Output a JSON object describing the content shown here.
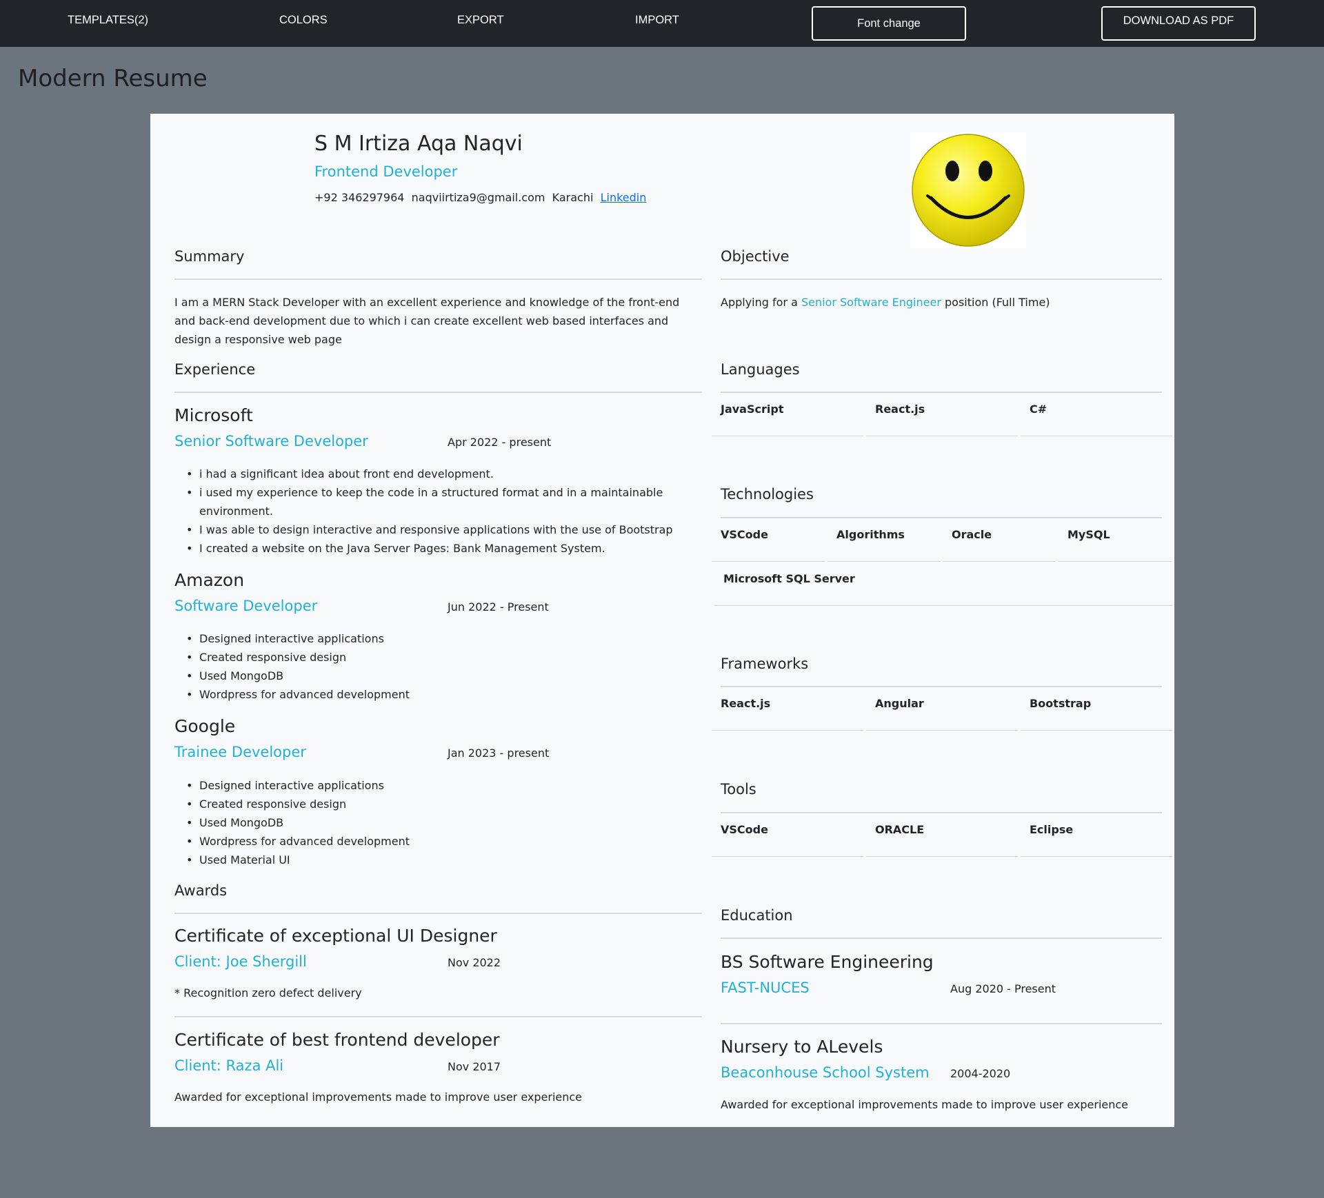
{
  "navbar": {
    "templates": "TEMPLATES(2)",
    "colors": "COLORS",
    "export": "EXPORT",
    "import": "IMPORT",
    "font_change": "Font change",
    "download": "DOWNLOAD AS PDF"
  },
  "page_title": "Modern Resume",
  "header": {
    "name": "S M Irtiza Aqa Naqvi",
    "role": "Frontend Developer",
    "phone": "+92 346297964",
    "email": "naqviirtiza9@gmail.com",
    "city": "Karachi",
    "linkedin": "Linkedin"
  },
  "summary": {
    "title": "Summary",
    "text": "I am a MERN Stack Developer with an excellent experience and knowledge of the front-end and back-end development due to which i can create excellent web based interfaces and design a responsive web page"
  },
  "objective": {
    "title": "Objective",
    "prefix": "Applying for a",
    "position": "Senior Software Engineer",
    "suffix": "position (Full Time)"
  },
  "experience": {
    "title": "Experience",
    "items": [
      {
        "company": "Microsoft",
        "role": "Senior Software Developer",
        "date": "Apr 2022 - present",
        "bullets": [
          "i had a significant idea about front end development.",
          "i used my experience to keep the code in a structured format and in a maintainable environment.",
          "I was able to design interactive and responsive applications with the use of Bootstrap",
          "I created a website on the Java Server Pages: Bank Management System."
        ]
      },
      {
        "company": "Amazon",
        "role": "Software Developer",
        "date": "Jun 2022 - Present",
        "bullets": [
          "Designed interactive applications",
          "Created responsive design",
          "Used MongoDB",
          "Wordpress for advanced development"
        ]
      },
      {
        "company": "Google",
        "role": "Trainee Developer",
        "date": "Jan 2023 - present",
        "bullets": [
          "Designed interactive applications",
          "Created responsive design",
          "Used MongoDB",
          "Wordpress for advanced development",
          "Used Material UI"
        ]
      }
    ]
  },
  "awards": {
    "title": "Awards",
    "items": [
      {
        "title": "Certificate of exceptional UI Designer",
        "client": "Client: Joe Shergill",
        "date": "Nov 2022",
        "desc": "* Recognition zero defect delivery"
      },
      {
        "title": "Certificate of best frontend developer",
        "client": "Client: Raza Ali",
        "date": "Nov 2017",
        "desc": "Awarded for exceptional improvements made to improve user experience"
      }
    ]
  },
  "languages": {
    "title": "Languages",
    "items": [
      "JavaScript",
      "React.js",
      "C#"
    ]
  },
  "technologies": {
    "title": "Technologies",
    "items": [
      "VSCode",
      "Algorithms",
      "Oracle",
      "MySQL",
      "Microsoft SQL Server"
    ]
  },
  "frameworks": {
    "title": "Frameworks",
    "items": [
      "React.js",
      "Angular",
      "Bootstrap"
    ]
  },
  "tools": {
    "title": "Tools",
    "items": [
      "VSCode",
      "ORACLE",
      "Eclipse"
    ]
  },
  "education": {
    "title": "Education",
    "items": [
      {
        "degree": "BS Software Engineering",
        "school": "FAST-NUCES",
        "date": "Aug 2020 - Present",
        "desc": ""
      },
      {
        "degree": "Nursery to ALevels",
        "school": "Beaconhouse School System",
        "date": "2004-2020",
        "desc": "Awarded for exceptional improvements made to improve user experience"
      }
    ]
  },
  "colors": {
    "accent": "#1fb1d6",
    "navbar": "#212529",
    "background": "#6c747e",
    "paper": "#f8f9fa"
  },
  "icons": {
    "profile_image": "smiley-face-icon"
  }
}
